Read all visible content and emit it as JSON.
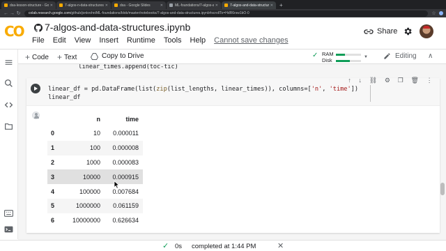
{
  "browser": {
    "tabs": [
      {
        "label": "dsa-lesson-structure - Google S"
      },
      {
        "label": "7-algos-n-data-structures - G"
      },
      {
        "label": "dsa - Google Slides"
      },
      {
        "label": "ML-foundations/7-algos-and-"
      },
      {
        "label": "7-algos-and-data-structures.i",
        "active": true
      }
    ],
    "url_host": "colab.research.google.com",
    "url_path": "/github/jonkrohn/ML-foundations/blob/master/notebooks/7-algos-and-data-structures.ipynb#scrollTo=HdR6rsw1bO-0"
  },
  "header": {
    "logo": "CO",
    "title": "7-algos-and-data-structures.ipynb",
    "share_label": "Share",
    "menu": [
      "File",
      "Edit",
      "View",
      "Insert",
      "Runtime",
      "Tools",
      "Help"
    ],
    "unsaved": "Cannot save changes"
  },
  "toolbar": {
    "code_label": "Code",
    "text_label": "Text",
    "copy_label": "Copy to Drive",
    "ram_label": "RAM",
    "disk_label": "Disk",
    "ram_fraction": 0.35,
    "disk_fraction": 0.55,
    "editing_label": "Editing"
  },
  "notebook": {
    "previous_line": "    linear_times.append(toc-tic)",
    "code_line1_pre": "linear_df = pd.DataFrame(list(",
    "code_line1_fn": "zip",
    "code_line1_mid": "(list_lengths, linear_times)), columns=[",
    "code_line1_s1": "'n'",
    "code_line1_sep": ", ",
    "code_line1_s2": "'time'",
    "code_line1_end": "])",
    "code_line2": "linear_df",
    "table": {
      "columns": [
        "n",
        "time"
      ],
      "rows": [
        {
          "idx": "0",
          "n": "10",
          "time": "0.000011"
        },
        {
          "idx": "1",
          "n": "100",
          "time": "0.000008"
        },
        {
          "idx": "2",
          "n": "1000",
          "time": "0.000083"
        },
        {
          "idx": "3",
          "n": "10000",
          "time": "0.000915"
        },
        {
          "idx": "4",
          "n": "100000",
          "time": "0.007684"
        },
        {
          "idx": "5",
          "n": "1000000",
          "time": "0.061159"
        },
        {
          "idx": "6",
          "n": "10000000",
          "time": "0.626634"
        }
      ],
      "hover_row": 3
    }
  },
  "status": {
    "duration": "0s",
    "completed": "completed at 1:44 PM"
  },
  "colors": {
    "accent_green": "#0f9d58",
    "logo_orange": "#f9ab00",
    "logo_dark_orange": "#e8710a"
  }
}
